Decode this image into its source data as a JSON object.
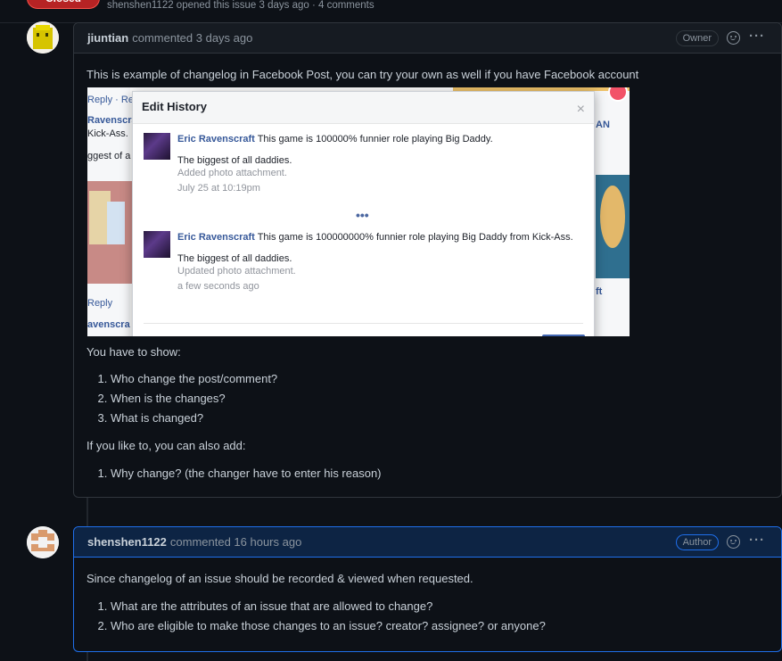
{
  "issue_meta": {
    "state_label": "Closed",
    "text": "shenshen1122 opened this issue 3 days ago · 4 comments"
  },
  "comments": [
    {
      "author": "jiuntian",
      "header_text": "commented 3 days ago",
      "role": "Owner",
      "body": {
        "intro": "This is example of changelog in Facebook Post, you can try your own as well if you have Facebook account",
        "show_heading": "You have to show:",
        "show_items": [
          "Who change the post/comment?",
          "When is the changes?",
          "What is changed?"
        ],
        "extra_heading": "If you like to, you can also add:",
        "extra_items": [
          "Why change? (the changer have to enter his reason)"
        ]
      },
      "screenshot": {
        "modal_title": "Edit History",
        "close_glyph": "×",
        "more_glyph": "•••",
        "side_labels": [
          "Reply · Re",
          "Ravenscra",
          "Kick-Ass.",
          "ggest of a",
          "Reply",
          "avenscra",
          "AN",
          "ft"
        ],
        "entries": [
          {
            "name": "Eric Ravenscraft",
            "text": "This game is 100000% funnier role playing Big Daddy.",
            "line": "The biggest of all daddies.",
            "note": "Added photo attachment.",
            "time": "July 25 at 10:19pm"
          },
          {
            "name": "Eric Ravenscraft",
            "text": "This game is 100000000% funnier role playing Big Daddy from Kick-Ass.",
            "line": "The biggest of all daddies.",
            "note": "Updated photo attachment.",
            "time": "a few seconds ago"
          }
        ]
      }
    },
    {
      "author": "shenshen1122",
      "header_text": "commented 16 hours ago",
      "role": "Author",
      "body": {
        "intro": "Since changelog of an issue should be recorded & viewed when requested.",
        "items": [
          "What are the attributes of an issue that are allowed to change?",
          "Who are eligible to make those changes to an issue? creator? assignee? or anyone?"
        ]
      }
    }
  ],
  "icons": {
    "reaction": "smiley-icon",
    "menu": "kebab-icon",
    "menu_glyph": "···"
  },
  "colors": {
    "background": "#0d1117",
    "border": "#30363d",
    "accent": "#1f6feb",
    "closed": "#b62324",
    "fb_link": "#365899"
  }
}
